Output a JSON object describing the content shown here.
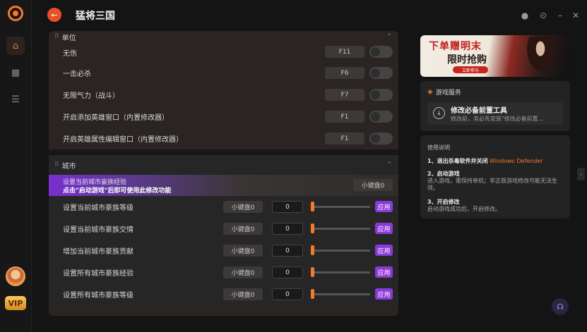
{
  "app": {
    "title": "猛将三国",
    "vip_label": "VIP"
  },
  "rail": {
    "items": [
      {
        "name": "home-icon",
        "glyph": "⌂"
      },
      {
        "name": "games-icon",
        "glyph": "▦"
      },
      {
        "name": "storage-icon",
        "glyph": "☰"
      }
    ]
  },
  "sections": {
    "unit": {
      "title": "单位",
      "rows": [
        {
          "label": "无伤",
          "hotkey": "F11"
        },
        {
          "label": "一击必杀",
          "hotkey": "F6"
        },
        {
          "label": "无限气力（战斗）",
          "hotkey": "F7"
        },
        {
          "label": "开启添加英雄窗口（内置修改器）",
          "hotkey": "F1"
        },
        {
          "label": "开启英雄属性编辑窗口（内置修改器）",
          "hotkey": "F1"
        }
      ]
    },
    "city": {
      "title": "城市",
      "highlight": {
        "label": "设置当前城市豪族经验",
        "notice": "点击\"启动游戏\"后即可使用此修改功能",
        "hotkey": "小键盘0"
      },
      "rows": [
        {
          "label": "设置当前城市豪族等级",
          "hotkey": "小键盘0",
          "value": "0",
          "apply": "应用"
        },
        {
          "label": "设置当前城市豪族交情",
          "hotkey": "小键盘0",
          "value": "0",
          "apply": "应用"
        },
        {
          "label": "增加当前城市豪族贡献",
          "hotkey": "小键盘0",
          "value": "0",
          "apply": "应用"
        },
        {
          "label": "设置所有城市豪族经验",
          "hotkey": "小键盘0",
          "value": "0",
          "apply": "应用"
        },
        {
          "label": "设置所有城市豪族等级",
          "hotkey": "小键盘0",
          "value": "0",
          "apply": "应用"
        }
      ]
    }
  },
  "banner": {
    "line1": "下单赠明末",
    "line2": "限时抢购",
    "button": "立即参与"
  },
  "service": {
    "title": "游戏服务",
    "item_title": "修改必备前置工具",
    "item_desc": "修改前，务必先安装\"修改必备前置..."
  },
  "guide": {
    "title": "使用说明",
    "step1_title": "1、退出杀毒软件并关闭",
    "step1_warn": "Windows Defender",
    "step2_title": "2、启动游戏",
    "step2_desc": "进入游戏，需保持单机；非正版游戏修改可能无法生效。",
    "step3_title": "3、开启修改",
    "step3_desc": "启动游戏成功后，开启修改。"
  }
}
